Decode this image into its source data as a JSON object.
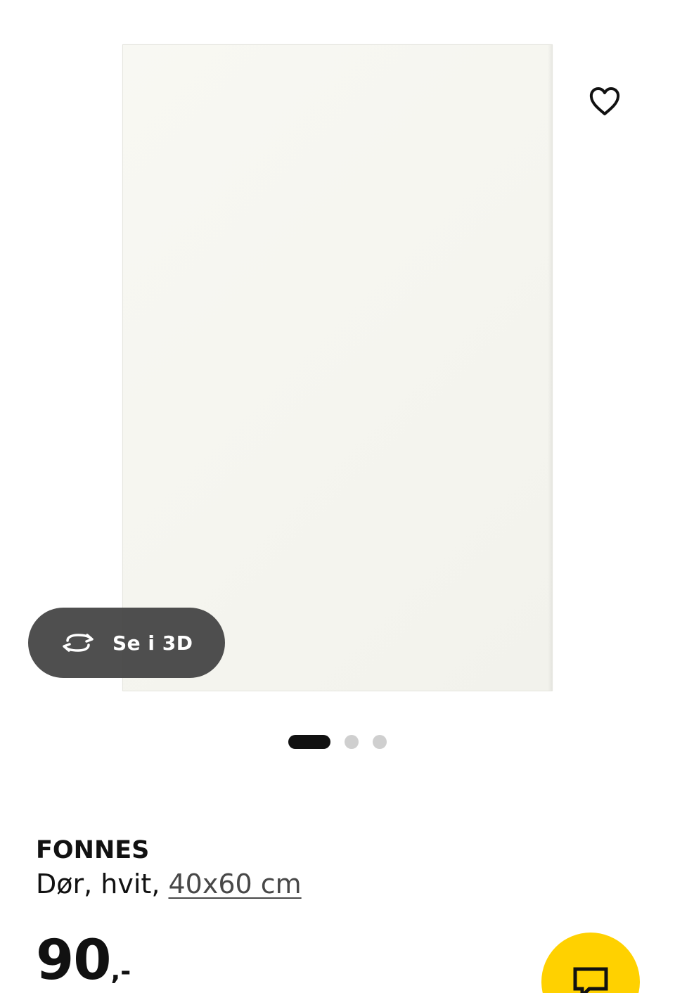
{
  "gallery": {
    "see_3d_label": "Se i 3D",
    "icons": {
      "favorite": "heart-outline-icon",
      "rotate": "rotate-3d-icon"
    },
    "dots_count": 3,
    "active_dot": 1
  },
  "product": {
    "name": "FONNES",
    "description_prefix": "Dør, hvit, ",
    "size": "40x60 cm",
    "price_amount": "90",
    "price_suffix": ",-"
  },
  "chat": {
    "icon": "chat-icon"
  },
  "colors": {
    "accent": "#ffd100",
    "text": "#111111",
    "button_overlay": "#3c3c3c",
    "dot_inactive": "#cfcfcf",
    "dot_active": "#111111",
    "image_background": "#f6f6f0"
  }
}
